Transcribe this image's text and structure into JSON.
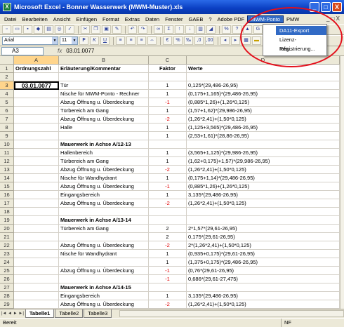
{
  "window": {
    "title": "Microsoft Excel - Bonner Wasserwerk (MWM-Muster).xls",
    "min": "_",
    "max": "□",
    "close": "X"
  },
  "menubar": {
    "items": [
      "Datei",
      "Bearbeiten",
      "Ansicht",
      "Einfügen",
      "Format",
      "Extras",
      "Daten",
      "Fenster",
      "GAEB",
      "?",
      "Adobe PDF",
      "MWM-Ponto",
      "PMW"
    ],
    "doc_controls": "_ □ X"
  },
  "mwm_menu": {
    "items": [
      "DA11-Export",
      "Lizenz-Registrierung...",
      "Info..."
    ]
  },
  "toolbar2": {
    "font": "Arial",
    "size": "11",
    "bold": "F",
    "italic": "K",
    "underline": "U",
    "euro": "€"
  },
  "formula": {
    "cell_ref": "A3",
    "fx": "fx",
    "value": "03.01.0077"
  },
  "columns": [
    "A",
    "B",
    "C",
    "D"
  ],
  "rows": [
    {
      "n": "1",
      "A": "Ordnungszahl",
      "B": "Erläuterung/Kommentar",
      "C": "Faktor",
      "D": "Werte",
      "bold": true
    },
    {
      "n": "2",
      "A": "",
      "B": "",
      "C": "",
      "D": ""
    },
    {
      "n": "3",
      "A": "03.01.0077",
      "B": "Tür",
      "C": "1",
      "D": "0,125*(29,486-26,95)"
    },
    {
      "n": "4",
      "A": "",
      "B": "Nische für MWM-Ponto - Rechner",
      "C": "1",
      "D": "(0,175+1,165)*(29,486-26,95)"
    },
    {
      "n": "5",
      "A": "",
      "B": "Abzug Öffnung u. Überdeckung",
      "C": "-1",
      "D": "(0,885*1,26)+(1,26*0,125)"
    },
    {
      "n": "6",
      "A": "",
      "B": "Türbereich am Gang",
      "C": "1",
      "D": "(1,57+1,62)*(29,986-26,95)"
    },
    {
      "n": "7",
      "A": "",
      "B": "Abzug Öffnung u. Überdeckung",
      "C": "-2",
      "D": "(1,26*2,41)+(1,50*0,125)"
    },
    {
      "n": "8",
      "A": "",
      "B": "Halle",
      "C": "1",
      "D": "(1,125+3,565)*(29,486-26,95)"
    },
    {
      "n": "9",
      "A": "",
      "B": "",
      "C": "1",
      "D": "(2,53+1,61)*(28,86-26,95)"
    },
    {
      "n": "10",
      "A": "",
      "B": "Mauerwerk in Achse A/12-13",
      "C": "",
      "D": "",
      "boldB": true
    },
    {
      "n": "11",
      "A": "",
      "B": "Hallenbereich",
      "C": "1",
      "D": "(3,565+1,125)*(29,986-26,95)"
    },
    {
      "n": "12",
      "A": "",
      "B": "Türbereich am Gang",
      "C": "1",
      "D": "(1,62+0,175)+1,57)*(29,986-26,95)"
    },
    {
      "n": "13",
      "A": "",
      "B": "Abzug Öffnung u. Überdeckung",
      "C": "-2",
      "D": "(1,26*2,41)+(1,50*0,125)"
    },
    {
      "n": "14",
      "A": "",
      "B": "Nische für Wandhydrant",
      "C": "1",
      "D": "(0,175+1,14)*(29,486-26,95)"
    },
    {
      "n": "15",
      "A": "",
      "B": "Abzug Öffnung u. Überdeckung",
      "C": "-1",
      "D": "(0,885*1,26)+(1,26*0,125)"
    },
    {
      "n": "16",
      "A": "",
      "B": "Eingangsbereich",
      "C": "1",
      "D": "3,135*(29,486-26,95)"
    },
    {
      "n": "17",
      "A": "",
      "B": "Abzug Öffnung u. Überdeckung",
      "C": "-2",
      "D": "(1,26*2,41)+(1,50*0,125)"
    },
    {
      "n": "18",
      "A": "",
      "B": "",
      "C": "",
      "D": ""
    },
    {
      "n": "19",
      "A": "",
      "B": "Mauerwerk in Achse A/13-14",
      "C": "",
      "D": "",
      "boldB": true
    },
    {
      "n": "20",
      "A": "",
      "B": "Türbereich am Gang",
      "C": "2",
      "D": "2*1,57*(29,61-26,95)"
    },
    {
      "n": "21",
      "A": "",
      "B": "",
      "C": "2",
      "D": "0,175*(29,61-26,95)"
    },
    {
      "n": "22",
      "A": "",
      "B": "Abzug Öffnung u. Überdeckung",
      "C": "-2",
      "D": "2*(1,26*2,41)+(1,50*0,125)"
    },
    {
      "n": "23",
      "A": "",
      "B": "Nische für Wandhydrant",
      "C": "1",
      "D": "(0,935+0,175)*(29,61-26,95)"
    },
    {
      "n": "24",
      "A": "",
      "B": "",
      "C": "1",
      "D": "(1,375+0,175)*(29,486-26,95)"
    },
    {
      "n": "25",
      "A": "",
      "B": "Abzug Öffnung u. Überdeckung",
      "C": "-1",
      "D": "(0,76*(29,61-26,95)"
    },
    {
      "n": "26",
      "A": "",
      "B": "",
      "C": "-1",
      "D": "0,686*(29,61-27,475)"
    },
    {
      "n": "27",
      "A": "",
      "B": "Mauerwerk in Achse A/14-15",
      "C": "",
      "D": "",
      "boldB": true
    },
    {
      "n": "28",
      "A": "",
      "B": "Eingangsbereich",
      "C": "1",
      "D": "3,135*(29,486-26,95)"
    },
    {
      "n": "29",
      "A": "",
      "B": "Abzug Öffnung u. Überdeckung",
      "C": "-2",
      "D": "(1,26*2,41)+(1,50*0,125)"
    },
    {
      "n": "30",
      "A": "",
      "B": "",
      "C": "",
      "D": ""
    },
    {
      "n": "31",
      "A": "",
      "B": "",
      "C": "",
      "D": ""
    },
    {
      "n": "32",
      "A": "",
      "B": "",
      "C": "",
      "D": ""
    }
  ],
  "sheets": [
    "Tabelle1",
    "Tabelle2",
    "Tabelle3"
  ],
  "tabnav": "|◄ ◄ ► ►|",
  "status": {
    "left": "Bereit",
    "right": "NF"
  },
  "colors": {
    "highlight": "#316ac5",
    "negative": "#e00000",
    "annotation": "#e3101c"
  }
}
